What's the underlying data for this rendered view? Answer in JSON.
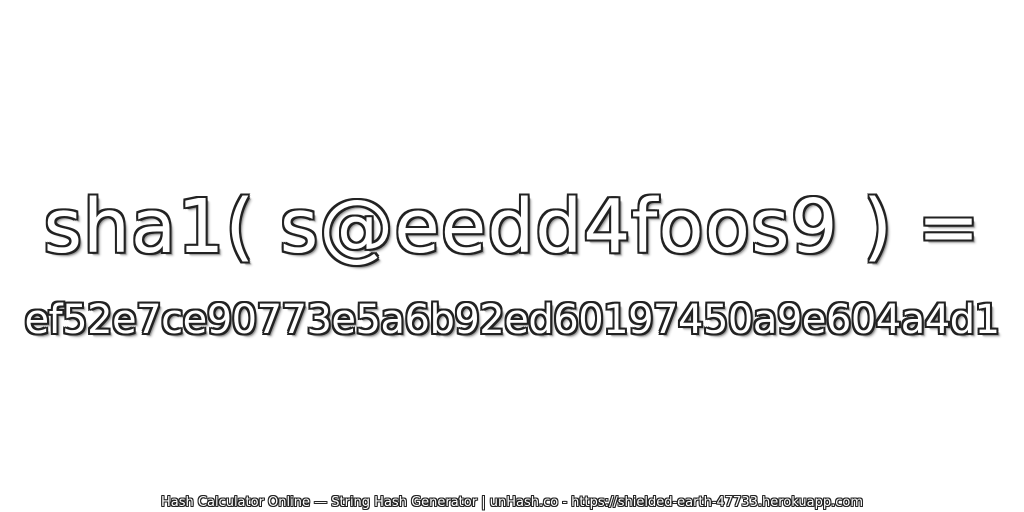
{
  "expression": "sha1( s@eedd4foos9 ) =",
  "hash": "ef52e7ce90773e5a6b92ed60197450a9e604a4d1",
  "footer": "Hash Calculator Online — String Hash Generator | unHash.co - https://shielded-earth-47733.herokuapp.com",
  "colors": {
    "text_fill": "#ffffff",
    "text_outline": "#222222",
    "background": "#ffffff"
  }
}
